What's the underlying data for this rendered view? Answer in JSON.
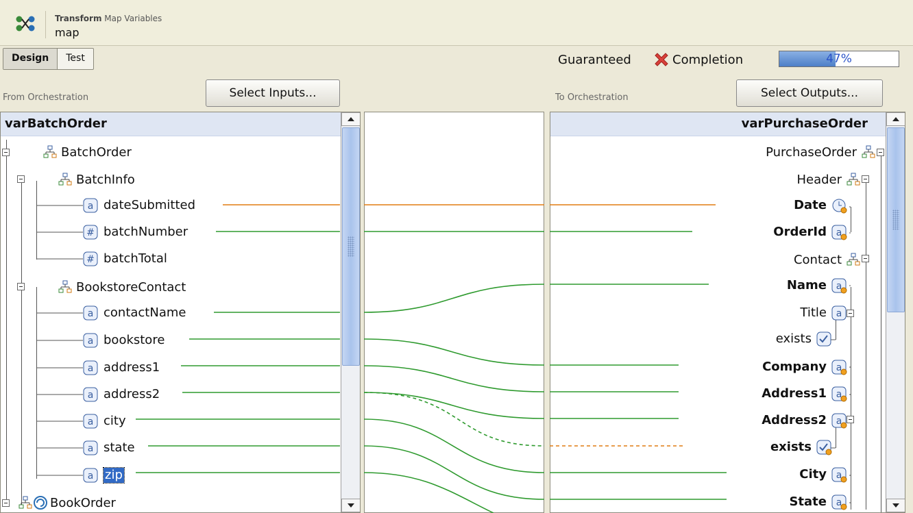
{
  "header": {
    "kind": "Transform",
    "subtitle": "Map Variables",
    "name": "map"
  },
  "tabs": [
    {
      "label": "Design",
      "active": true
    },
    {
      "label": "Test",
      "active": false
    }
  ],
  "status": {
    "guaranteed_label": "Guaranteed",
    "completion_label": "Completion",
    "progress": 0.47,
    "progress_text": "47%"
  },
  "left": {
    "section_label": "From Orchestration",
    "button": "Select Inputs...",
    "title": "varBatchOrder",
    "nodes": [
      "BatchOrder",
      "BatchInfo",
      "dateSubmitted",
      "batchNumber",
      "batchTotal",
      "BookstoreContact",
      "contactName",
      "bookstore",
      "address1",
      "address2",
      "city",
      "state",
      "zip",
      "BookOrder"
    ]
  },
  "right": {
    "section_label": "To Orchestration",
    "button": "Select Outputs...",
    "title": "varPurchaseOrder",
    "nodes": [
      "PurchaseOrder",
      "Header",
      "Date",
      "OrderId",
      "Contact",
      "Name",
      "Title",
      "exists",
      "Company",
      "Address1",
      "Address2",
      "exists",
      "City",
      "State"
    ]
  },
  "colors": {
    "line_green": "#2e9a2e",
    "line_orange": "#e07c10",
    "accent": "#316ac5"
  },
  "icons": [
    "map-icon",
    "record-icon",
    "string-icon",
    "number-icon",
    "datetime-icon",
    "boolean-icon",
    "loop-icon",
    "error-icon"
  ]
}
